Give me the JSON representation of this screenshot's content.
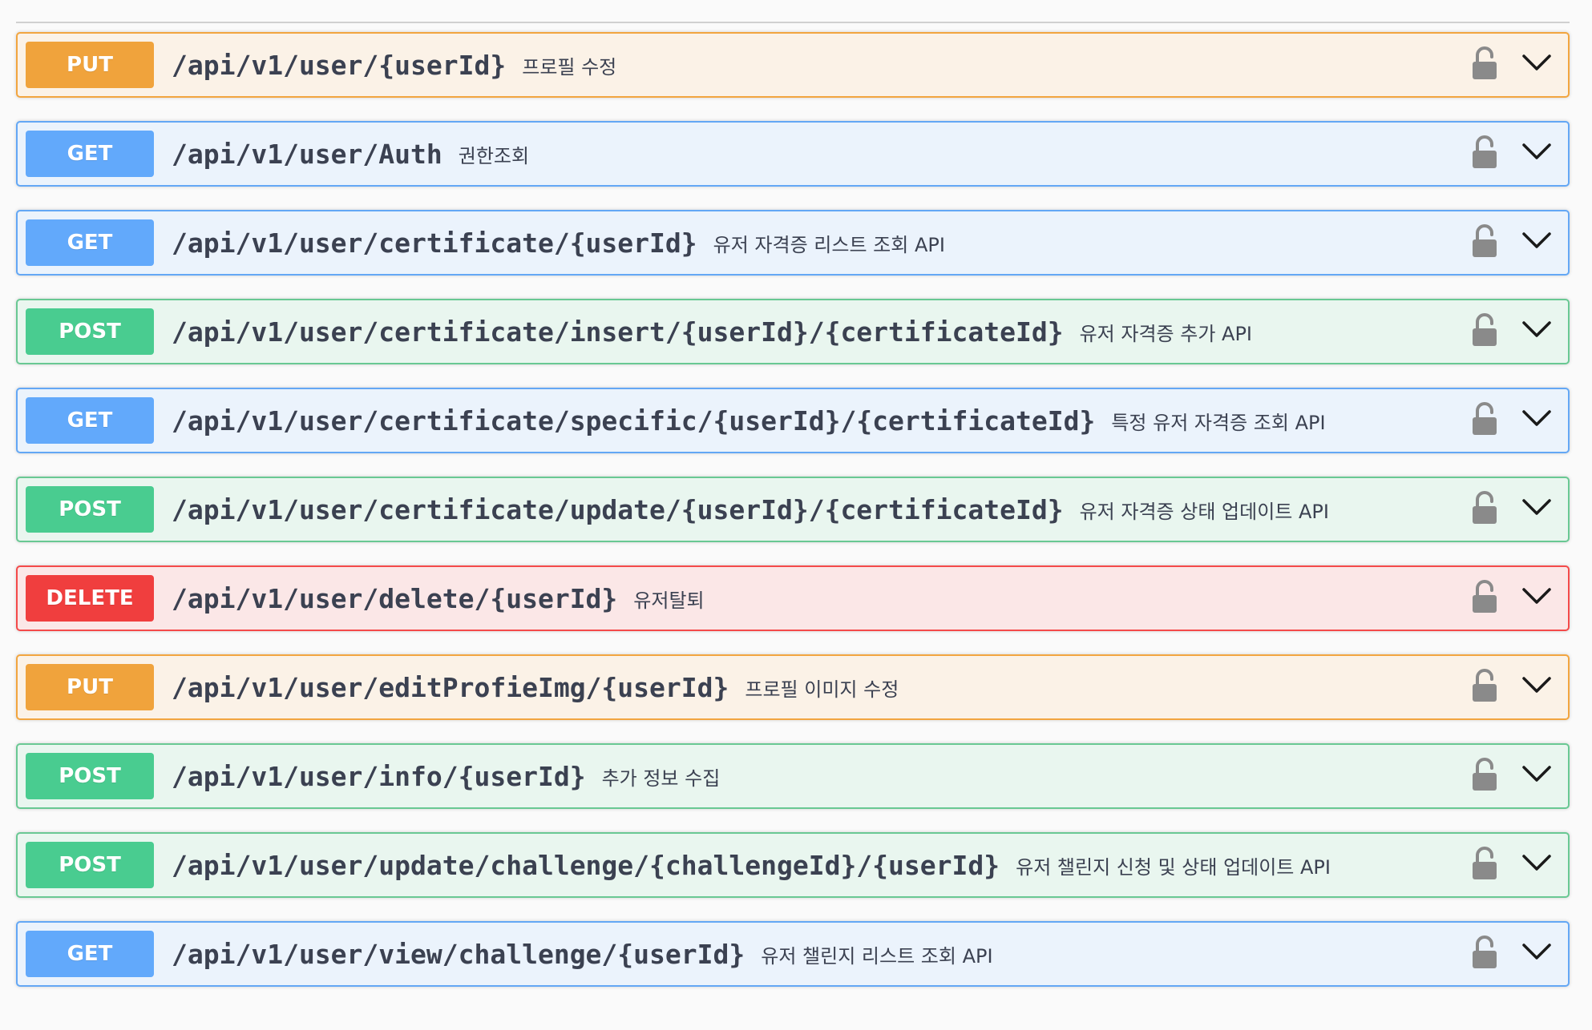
{
  "colors": {
    "PUT": {
      "badge": "#f0a33c",
      "border": "#f2a53f",
      "bg": "#fbf2e7"
    },
    "GET": {
      "badge": "#62a9fb",
      "border": "#63a7f5",
      "bg": "#ebf3fc"
    },
    "POST": {
      "badge": "#49cc90",
      "border": "#69c893",
      "bg": "#e9f6ef"
    },
    "DELETE": {
      "badge": "#f03e3e",
      "border": "#f44a4a",
      "bg": "#fbe7e7"
    }
  },
  "endpoints": [
    {
      "method": "PUT",
      "path": "/api/v1/user/{userId}",
      "summary": "프로필 수정",
      "lock_icon": "lock-open-icon",
      "toggle_icon": "chevron-down-icon"
    },
    {
      "method": "GET",
      "path": "/api/v1/user/Auth",
      "summary": "권한조회",
      "lock_icon": "lock-open-icon",
      "toggle_icon": "chevron-down-icon"
    },
    {
      "method": "GET",
      "path": "/api/v1/user/certificate/{userId}",
      "summary": "유저 자격증 리스트 조회 API",
      "lock_icon": "lock-open-icon",
      "toggle_icon": "chevron-down-icon"
    },
    {
      "method": "POST",
      "path": "/api/v1/user/certificate/insert/{userId}/{certificateId}",
      "summary": "유저 자격증 추가 API",
      "lock_icon": "lock-open-icon",
      "toggle_icon": "chevron-down-icon"
    },
    {
      "method": "GET",
      "path": "/api/v1/user/certificate/specific/{userId}/{certificateId}",
      "summary": "특정 유저 자격증 조회 API",
      "lock_icon": "lock-open-icon",
      "toggle_icon": "chevron-down-icon"
    },
    {
      "method": "POST",
      "path": "/api/v1/user/certificate/update/{userId}/{certificateId}",
      "summary": "유저 자격증 상태 업데이트 API",
      "lock_icon": "lock-open-icon",
      "toggle_icon": "chevron-down-icon"
    },
    {
      "method": "DELETE",
      "path": "/api/v1/user/delete/{userId}",
      "summary": "유저탈퇴",
      "lock_icon": "lock-open-icon",
      "toggle_icon": "chevron-down-icon"
    },
    {
      "method": "PUT",
      "path": "/api/v1/user/editProfieImg/{userId}",
      "summary": "프로필 이미지 수정",
      "lock_icon": "lock-open-icon",
      "toggle_icon": "chevron-down-icon"
    },
    {
      "method": "POST",
      "path": "/api/v1/user/info/{userId}",
      "summary": "추가 정보 수집",
      "lock_icon": "lock-open-icon",
      "toggle_icon": "chevron-down-icon"
    },
    {
      "method": "POST",
      "path": "/api/v1/user/update/challenge/{challengeId}/{userId}",
      "summary": "유저 챌린지 신청 및 상태 업데이트 API",
      "lock_icon": "lock-open-icon",
      "toggle_icon": "chevron-down-icon"
    },
    {
      "method": "GET",
      "path": "/api/v1/user/view/challenge/{userId}",
      "summary": "유저 챌린지 리스트 조회 API",
      "lock_icon": "lock-open-icon",
      "toggle_icon": "chevron-down-icon"
    }
  ]
}
